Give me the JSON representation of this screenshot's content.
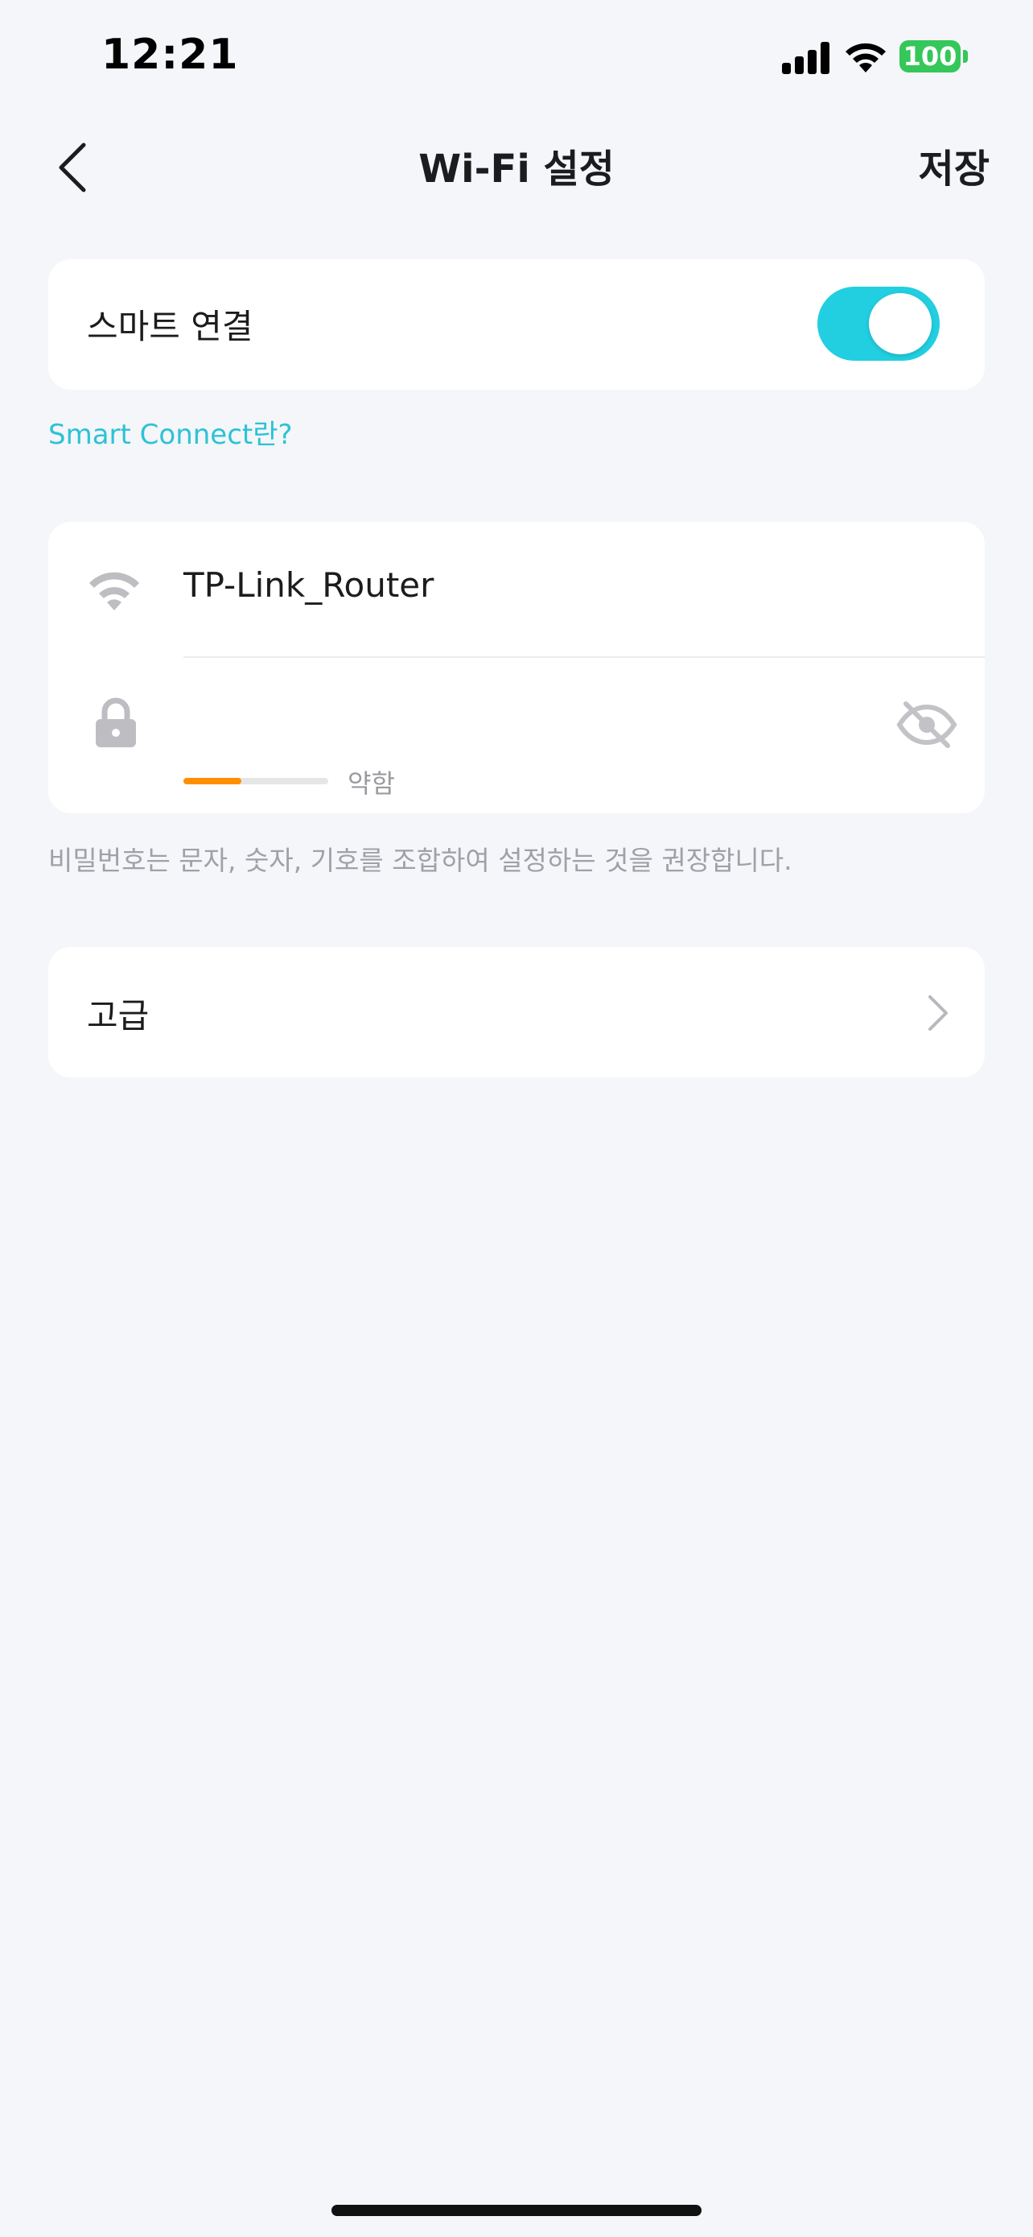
{
  "status_bar": {
    "time": "12:21",
    "battery": "100",
    "battery_color": "#35c759"
  },
  "nav": {
    "title": "Wi-Fi 설정",
    "save_label": "저장",
    "back_icon": "chevron-left-icon"
  },
  "smart_connect": {
    "label": "스마트 연결",
    "enabled": true,
    "toggle_color": "#22cfe0",
    "link": "Smart Connect란?",
    "link_color": "#2cc3d4"
  },
  "wifi": {
    "ssid": "TP-Link_Router",
    "password": "",
    "strength_label": "약함",
    "strength_fraction": 0.4,
    "strength_color": "#ff8f00",
    "hint": "비밀번호는 문자, 숫자, 기호를 조합하여 설정하는 것을 권장합니다."
  },
  "advanced": {
    "label": "고급"
  }
}
